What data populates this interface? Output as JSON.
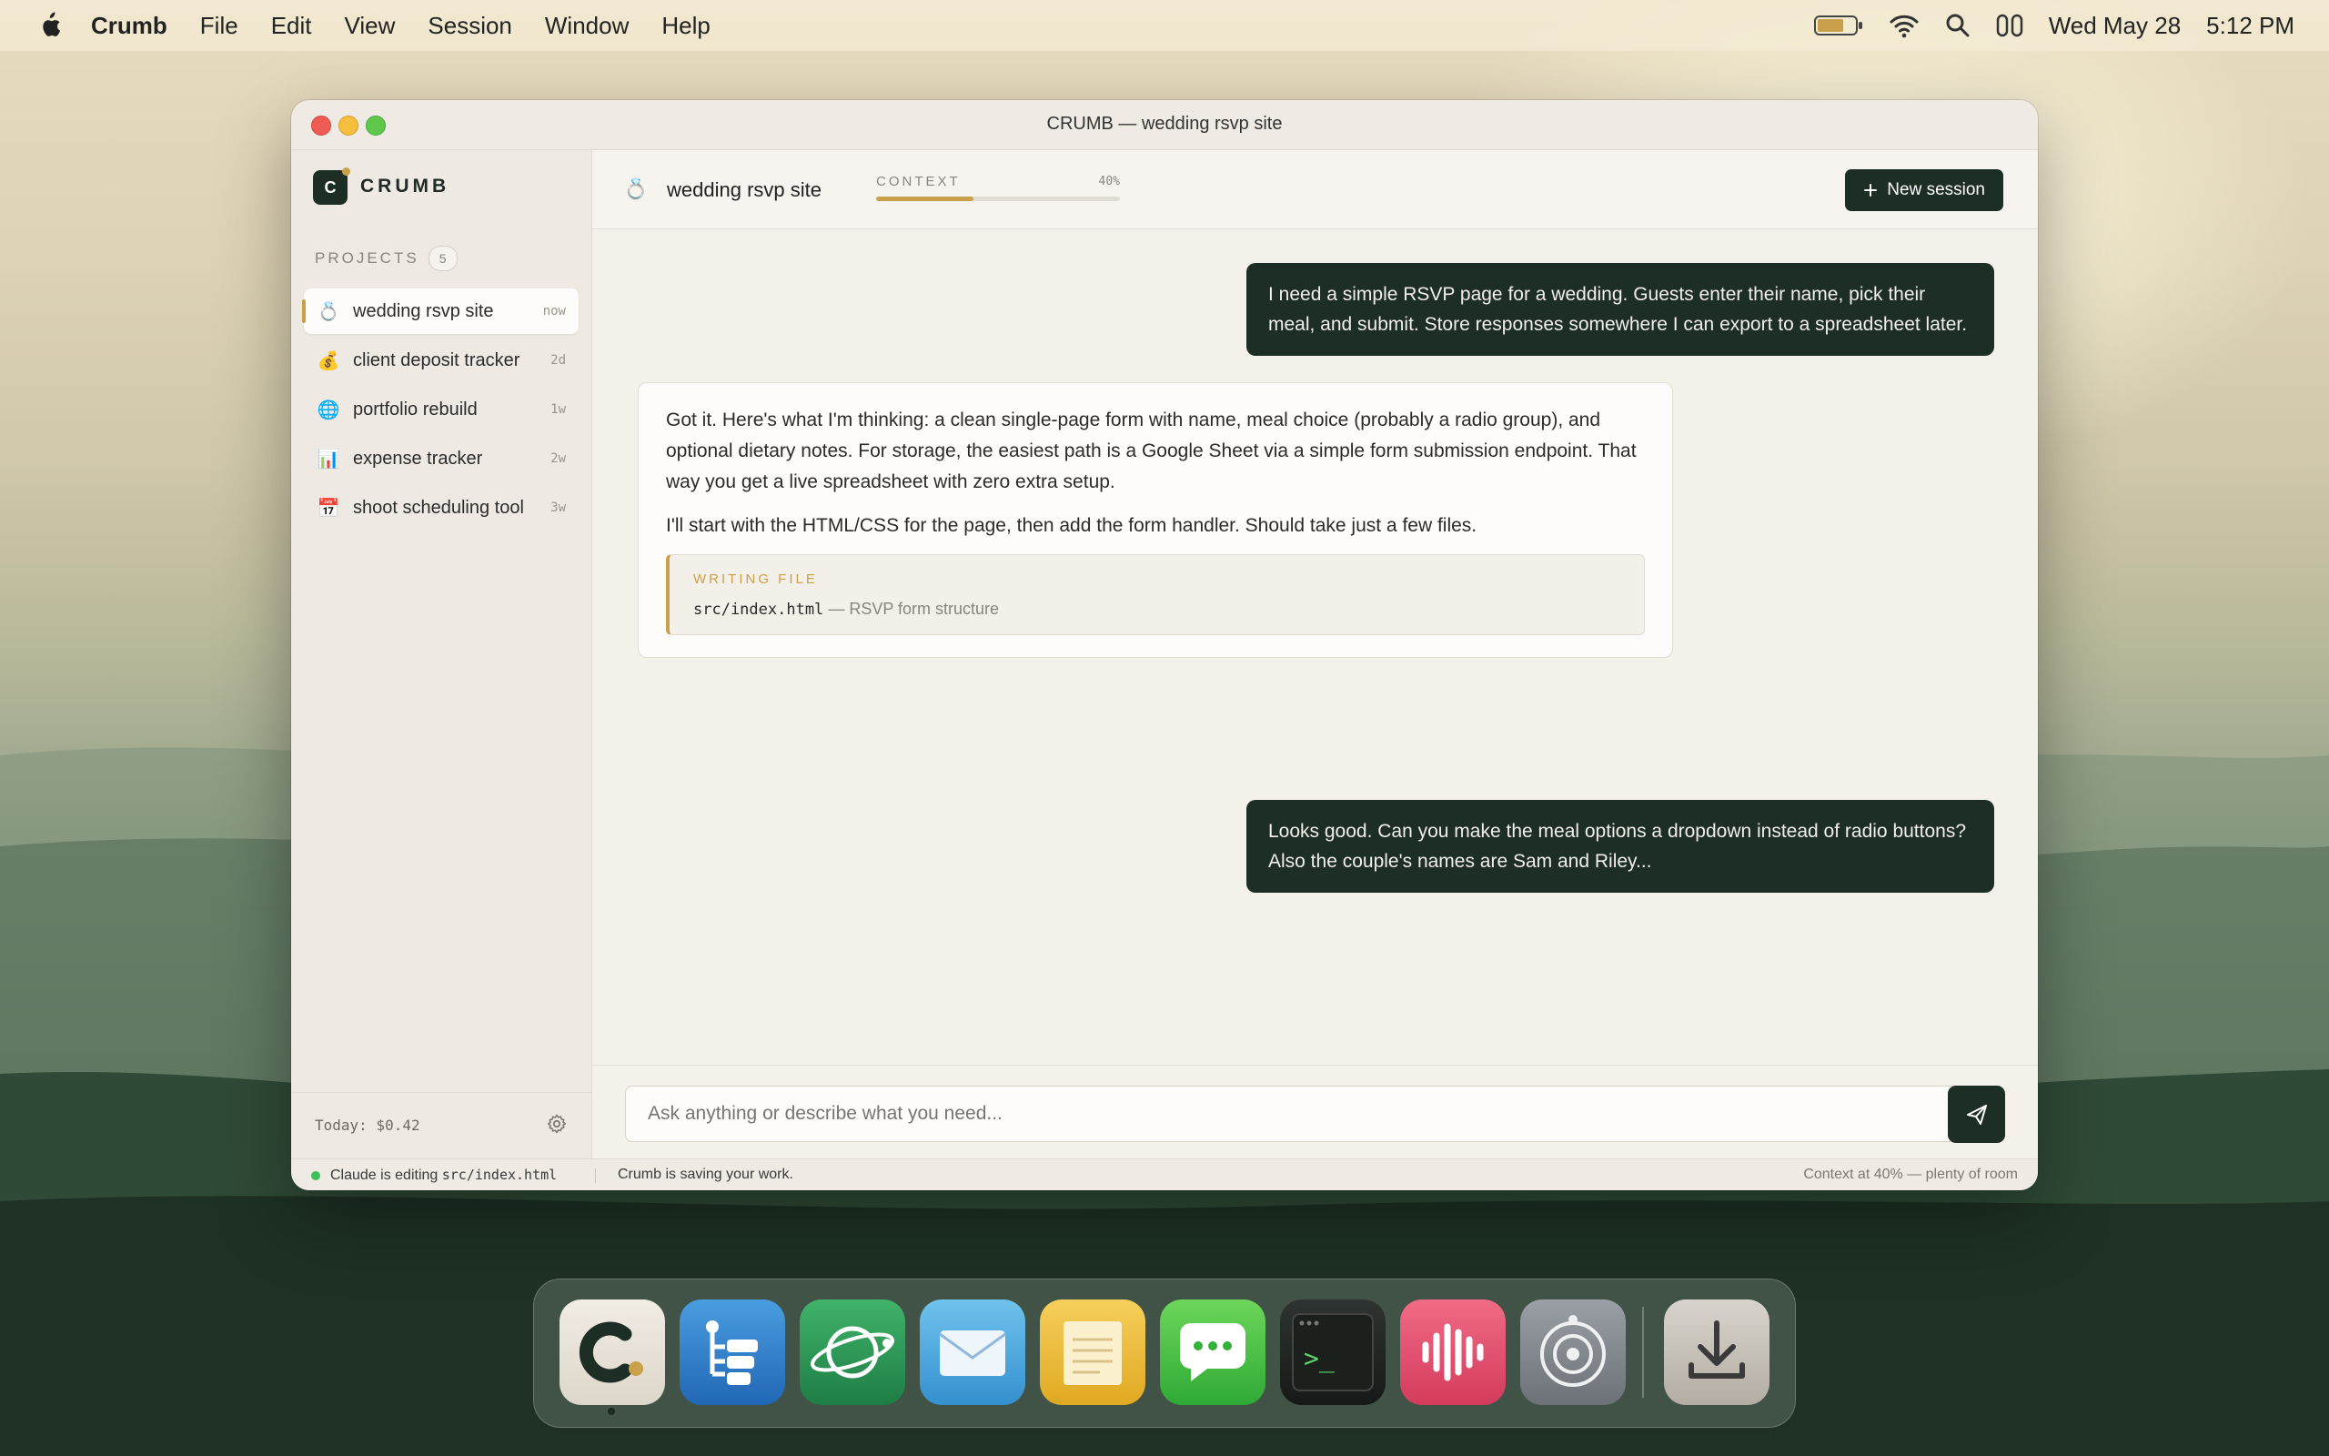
{
  "menubar": {
    "app_name": "Crumb",
    "items": [
      "File",
      "Edit",
      "View",
      "Session",
      "Window",
      "Help"
    ],
    "date": "Wed May 28",
    "time": "5:12 PM"
  },
  "window": {
    "title": "CRUMB — wedding rsvp site"
  },
  "sidebar": {
    "logo_letter": "C",
    "brand": "CRUMB",
    "projects_label": "PROJECTS",
    "projects_count": "5",
    "projects": [
      {
        "icon": "💍",
        "name": "wedding rsvp site",
        "time": "now",
        "active": true
      },
      {
        "icon": "💰",
        "name": "client deposit tracker",
        "time": "2d"
      },
      {
        "icon": "🌐",
        "name": "portfolio rebuild",
        "time": "1w"
      },
      {
        "icon": "📊",
        "name": "expense tracker",
        "time": "2w"
      },
      {
        "icon": "📅",
        "name": "shoot scheduling tool",
        "time": "3w"
      }
    ],
    "cost": "Today: $0.42"
  },
  "header": {
    "icon": "💍",
    "title": "wedding rsvp site",
    "context_label": "CONTEXT",
    "context_pct": "40%",
    "context_fraction": 0.4,
    "new_session": "New session"
  },
  "messages": {
    "user1": "I need a simple RSVP page for a wedding. Guests enter their name, pick their meal, and submit. Store responses somewhere I can export to a spreadsheet later.",
    "ai_p1": "Got it. Here's what I'm thinking: a clean single-page form with name, meal choice (probably a radio group), and optional dietary notes. For storage, the easiest path is a Google Sheet via a simple form submission endpoint. That way you get a live spreadsheet with zero extra setup.",
    "ai_p2": "I'll start with the HTML/CSS for the page, then add the form handler. Should take just a few files.",
    "file_label": "WRITING FILE",
    "file_path": "src/index.html",
    "file_desc": "RSVP form structure",
    "user2": "Looks good. Can you make the meal options a dropdown instead of radio buttons? Also the couple's names are Sam and Riley..."
  },
  "composer": {
    "placeholder": "Ask anything or describe what you need..."
  },
  "status": {
    "editing_prefix": "Claude is editing",
    "editing_file": "src/index.html",
    "saving": "Crumb is saving your work.",
    "context": "Context at 40% — plenty of room"
  },
  "colors": {
    "accent": "#c9a14a",
    "primary": "#1d2e24",
    "window_bg": "#f4f0ea"
  }
}
